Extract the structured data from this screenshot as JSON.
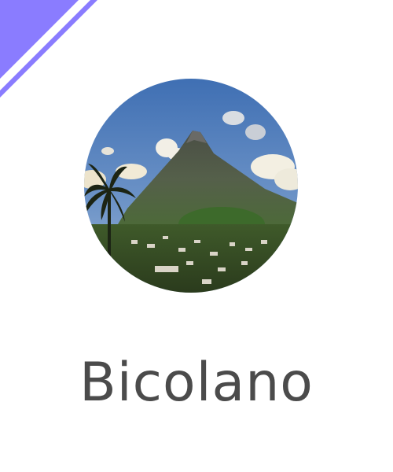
{
  "card": {
    "title": "Bicolano",
    "image_subject": "volcano-landscape-photo"
  },
  "colors": {
    "accent": "#8a7cff",
    "title_text": "#4b4b4b",
    "background": "#ffffff"
  }
}
